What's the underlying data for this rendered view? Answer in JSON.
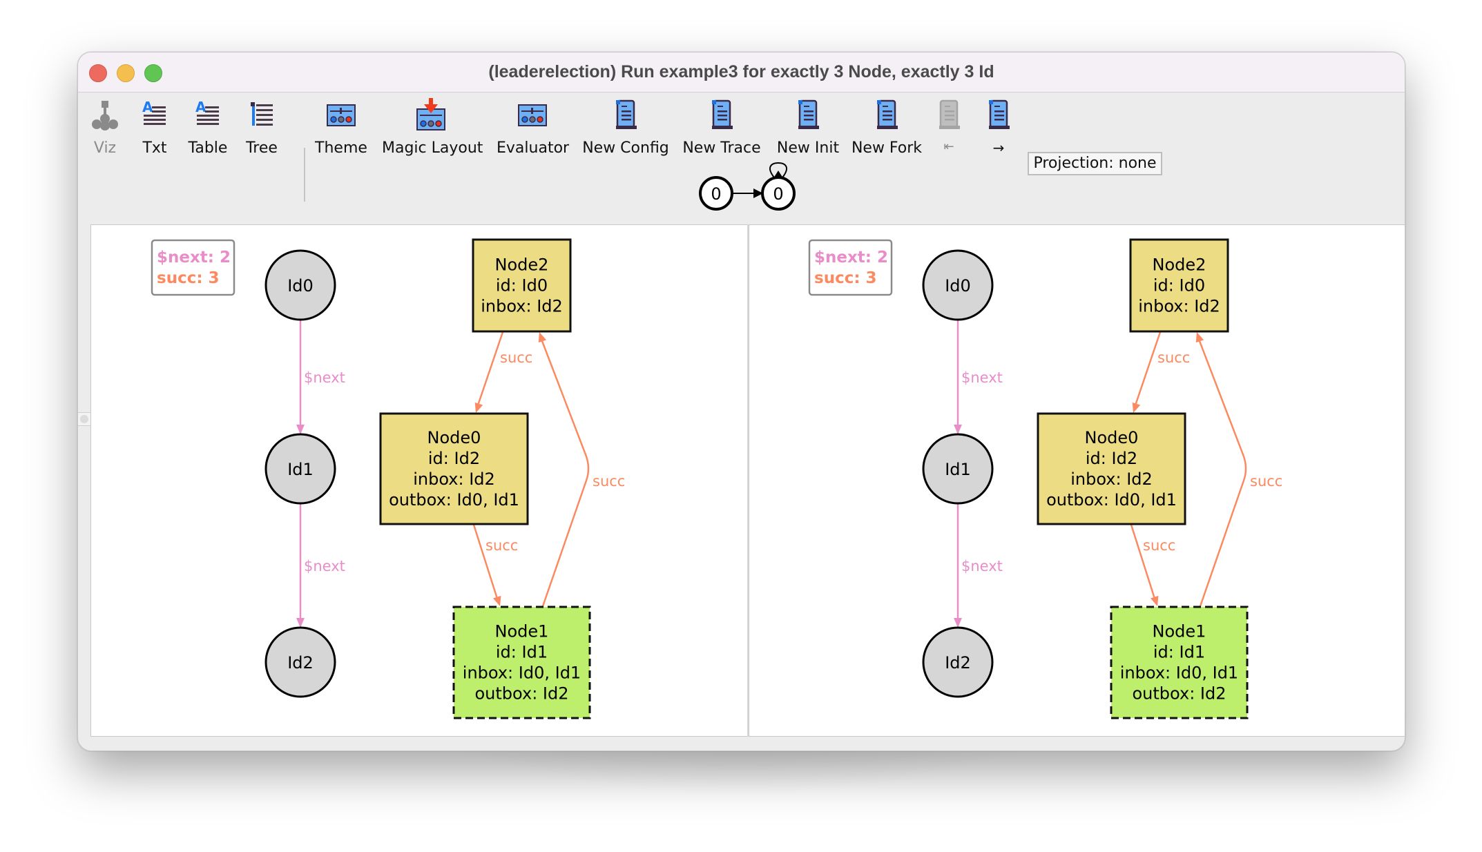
{
  "window": {
    "title": "(leaderelection) Run example3 for exactly 3 Node, exactly 3 Id"
  },
  "toolbar": {
    "buttons": [
      {
        "id": "viz",
        "label": "Viz",
        "icon": "graph-tree-icon",
        "enabled": false
      },
      {
        "id": "txt",
        "label": "Txt",
        "icon": "text-icon",
        "enabled": true
      },
      {
        "id": "table",
        "label": "Table",
        "icon": "table-icon",
        "enabled": true
      },
      {
        "id": "tree",
        "label": "Tree",
        "icon": "tree-list-icon",
        "enabled": true
      },
      {
        "id": "theme",
        "label": "Theme",
        "icon": "theme-sliders-icon",
        "enabled": true
      },
      {
        "id": "magic-layout",
        "label": "Magic Layout",
        "icon": "magic-layout-icon",
        "enabled": true
      },
      {
        "id": "evaluator",
        "label": "Evaluator",
        "icon": "evaluator-sliders-icon",
        "enabled": true
      },
      {
        "id": "new-config",
        "label": "New Config",
        "icon": "scroll-icon",
        "enabled": true
      },
      {
        "id": "new-trace",
        "label": "New Trace",
        "icon": "scroll-icon",
        "enabled": true
      },
      {
        "id": "new-init",
        "label": "New Init",
        "icon": "scroll-icon",
        "enabled": true
      },
      {
        "id": "new-fork",
        "label": "New Fork",
        "icon": "scroll-icon",
        "enabled": true
      },
      {
        "id": "first-state",
        "label": "⇤",
        "icon": "scroll-icon",
        "enabled": false
      },
      {
        "id": "next-state",
        "label": "→",
        "icon": "scroll-icon",
        "enabled": true
      }
    ],
    "projection_label": "Projection: none"
  },
  "state_graph": {
    "states": [
      {
        "label": "0",
        "current": false
      },
      {
        "label": "0",
        "current": true,
        "self_loop": true
      }
    ]
  },
  "colors": {
    "next_edge": "#e98dc9",
    "succ_edge": "#fb8a61",
    "node_fill": "#ecdd85",
    "current_node_fill": "#bdee6c",
    "id_fill": "#d6d6d6"
  },
  "panels": [
    {
      "name": "left",
      "legend": [
        {
          "text": "$next: 2",
          "type": "next"
        },
        {
          "text": "succ: 3",
          "type": "succ"
        }
      ],
      "ids": [
        {
          "label": "Id0"
        },
        {
          "label": "Id1"
        },
        {
          "label": "Id2"
        }
      ],
      "id_edges": [
        {
          "from": "Id0",
          "to": "Id1",
          "label": "$next"
        },
        {
          "from": "Id1",
          "to": "Id2",
          "label": "$next"
        }
      ],
      "nodes": [
        {
          "name": "Node2",
          "lines": [
            "Node2",
            "id: Id0",
            "inbox: Id2"
          ],
          "dashed": false
        },
        {
          "name": "Node0",
          "lines": [
            "Node0",
            "id: Id2",
            "inbox: Id2",
            "outbox: Id0, Id1"
          ],
          "dashed": false
        },
        {
          "name": "Node1",
          "lines": [
            "Node1",
            "id: Id1",
            "inbox: Id0, Id1",
            "outbox: Id2"
          ],
          "dashed": true
        }
      ],
      "node_edges": [
        {
          "from": "Node2",
          "to": "Node0",
          "label": "succ"
        },
        {
          "from": "Node0",
          "to": "Node1",
          "label": "succ"
        },
        {
          "from": "Node1",
          "to": "Node2",
          "label": "succ"
        }
      ]
    },
    {
      "name": "right",
      "legend": [
        {
          "text": "$next: 2",
          "type": "next"
        },
        {
          "text": "succ: 3",
          "type": "succ"
        }
      ],
      "ids": [
        {
          "label": "Id0"
        },
        {
          "label": "Id1"
        },
        {
          "label": "Id2"
        }
      ],
      "id_edges": [
        {
          "from": "Id0",
          "to": "Id1",
          "label": "$next"
        },
        {
          "from": "Id1",
          "to": "Id2",
          "label": "$next"
        }
      ],
      "nodes": [
        {
          "name": "Node2",
          "lines": [
            "Node2",
            "id: Id0",
            "inbox: Id2"
          ],
          "dashed": false
        },
        {
          "name": "Node0",
          "lines": [
            "Node0",
            "id: Id2",
            "inbox: Id2",
            "outbox: Id0, Id1"
          ],
          "dashed": false
        },
        {
          "name": "Node1",
          "lines": [
            "Node1",
            "id: Id1",
            "inbox: Id0, Id1",
            "outbox: Id2"
          ],
          "dashed": true
        }
      ],
      "node_edges": [
        {
          "from": "Node2",
          "to": "Node0",
          "label": "succ"
        },
        {
          "from": "Node0",
          "to": "Node1",
          "label": "succ"
        },
        {
          "from": "Node1",
          "to": "Node2",
          "label": "succ"
        }
      ]
    }
  ]
}
